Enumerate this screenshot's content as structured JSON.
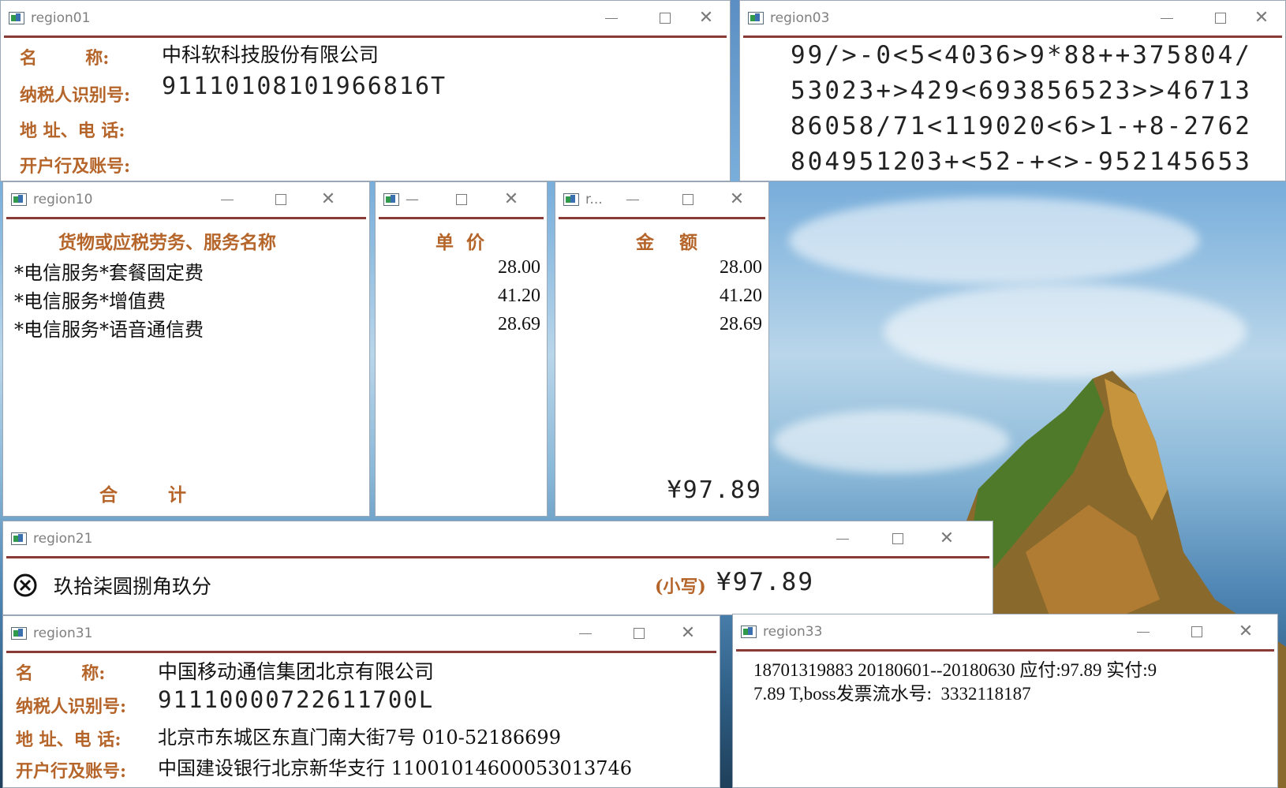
{
  "colors": {
    "label": "#b5652a",
    "border": "#8a3b36",
    "text": "#111111"
  },
  "icons": {
    "min": "minimize-icon",
    "max": "maximize-icon",
    "close": "close-icon",
    "app": "app-window-icon",
    "cancel": "circle-x-icon"
  },
  "win01": {
    "title": "region01",
    "name_label": "名        称:",
    "name_value": "中科软科技股份有限公司",
    "tax_label": "纳税人识别号:",
    "tax_value": "91110108101966816T",
    "addr_label": "地 址、电 话:",
    "bank_label": "开户行及账号:"
  },
  "win03": {
    "title": "region03",
    "lines": [
      "99/>-0<5<4036>9*88++375804/",
      "53023+>429<69385652З>>46713",
      "86058/71<119020<6>1-+8-2762",
      "804951203+<52-+<>-952145653"
    ]
  },
  "win10": {
    "title": "region10",
    "header": "货物或应税劳务、服务名称",
    "items": [
      "*电信服务*套餐固定费",
      "*电信服务*增值费",
      "*电信服务*语音通信费"
    ],
    "total_label": "合        计"
  },
  "winPrice": {
    "title": "—",
    "header": "单  价",
    "values": [
      "28.00",
      "41.20",
      "28.69"
    ]
  },
  "winAmount": {
    "title": "r...",
    "header": "金    额",
    "values": [
      "28.00",
      "41.20",
      "28.69"
    ],
    "total": "¥97.89"
  },
  "win21": {
    "title": "region21",
    "uppercase": "玖拾柒圆捌角玖分",
    "small_label": "(小写)",
    "small_value": "¥97.89"
  },
  "win31": {
    "title": "region31",
    "name_label": "名        称:",
    "name_value": "中国移动通信集团北京有限公司",
    "tax_label": "纳税人识别号:",
    "tax_value": "91110000722611700L",
    "addr_label": "地 址、电 话:",
    "addr_value": "北京市东城区东直门南大街7号 010-52186699",
    "bank_label": "开户行及账号:",
    "bank_value": "中国建设银行北京新华支行 11001014600053013746"
  },
  "win33": {
    "title": "region33",
    "line1": "18701319883 20180601--20180630 应付:97.89 实付:9",
    "line2": "7.89 T,boss发票流水号:  3332118187"
  }
}
